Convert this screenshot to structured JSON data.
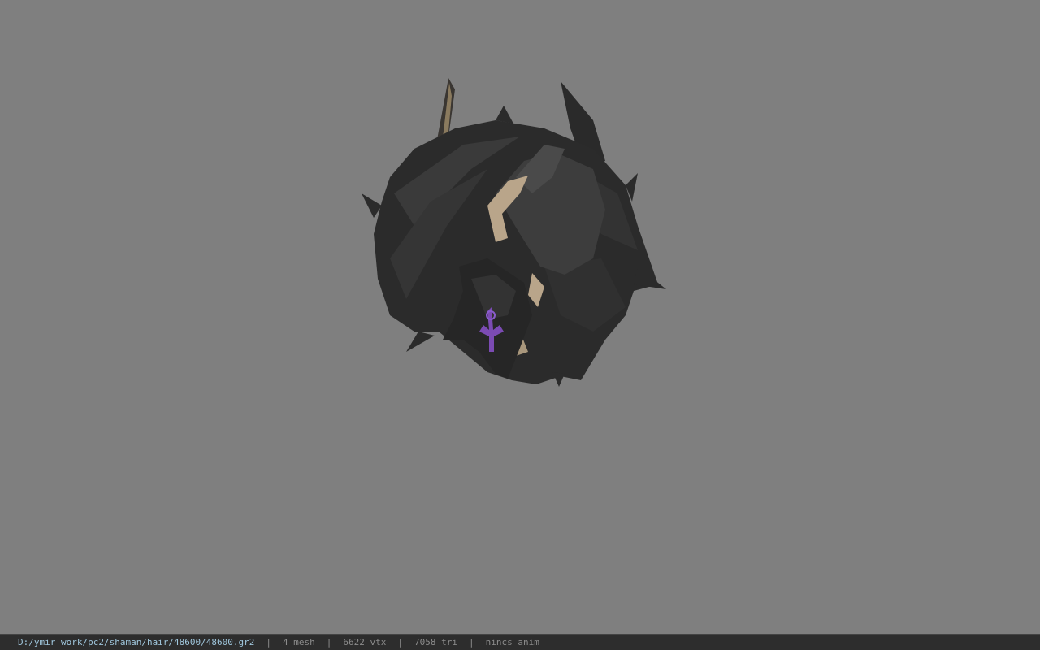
{
  "viewport": {
    "background_color": "#7f7f7f",
    "model_name": "shaman-hair-mesh"
  },
  "statusbar": {
    "path": "D:/ymir work/pc2/shaman/hair/48600/48600.gr2",
    "separator": "|",
    "mesh": "4 mesh",
    "vtx": "6622 vtx",
    "tri": "7058 tri",
    "anim": "nincs anim",
    "path_color": "#9fc6dc",
    "text_color": "#8c8c8c"
  }
}
